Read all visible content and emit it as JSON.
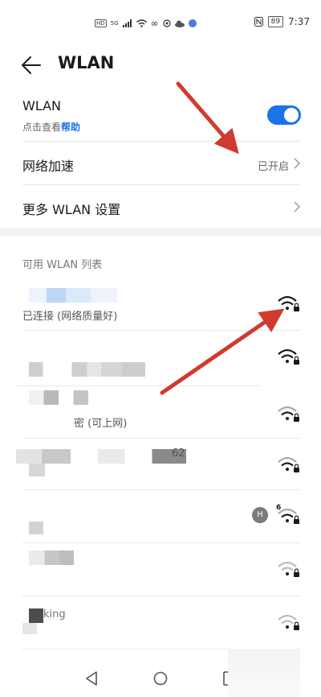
{
  "status_bar": {
    "hd": "HD",
    "signal": "5G",
    "infinity": "∞",
    "battery": "89",
    "time": "7:37"
  },
  "header": {
    "title": "WLAN"
  },
  "wlan_toggle": {
    "label": "WLAN",
    "sub_prefix": "点击查看",
    "sub_link": "帮助",
    "on": true
  },
  "settings": [
    {
      "label": "网络加速",
      "value": "已开启"
    },
    {
      "label": "更多 WLAN 设置",
      "value": ""
    }
  ],
  "networks_section": {
    "title": "可用 WLAN 列表",
    "items": [
      {
        "status": "已连接 (网络质量好)",
        "locked": true,
        "strength": "full"
      },
      {
        "status": "",
        "locked": true,
        "strength": "full"
      },
      {
        "status": "密 (可上网)",
        "locked": true,
        "strength": "good"
      },
      {
        "status": "",
        "locked": true,
        "strength": "good",
        "name_fragment": "62"
      },
      {
        "status": "",
        "locked": true,
        "strength": "good",
        "badge": "H",
        "wifi6": "6"
      },
      {
        "status": "",
        "locked": true,
        "strength": "weak"
      },
      {
        "status": "",
        "locked": true,
        "strength": "weak",
        "name_fragment": "king"
      }
    ]
  },
  "colors": {
    "accent": "#1a73e8",
    "annotation_arrow": "#d03a2f"
  }
}
